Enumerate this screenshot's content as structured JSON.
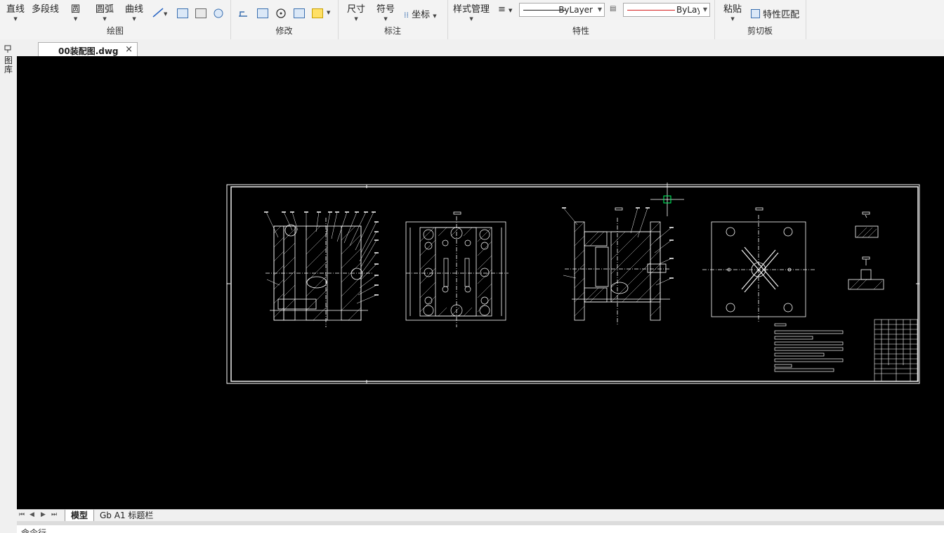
{
  "ribbon": {
    "draw": {
      "label": "绘图",
      "line": "直线",
      "polyline": "多段线",
      "circle": "圆",
      "arc": "圆弧",
      "curve": "曲线"
    },
    "modify": {
      "label": "修改"
    },
    "annotate": {
      "label": "标注",
      "dimension": "尺寸",
      "symbol": "符号",
      "coordinate": "坐标"
    },
    "properties": {
      "label": "特性",
      "style_manager": "样式管理",
      "linetype": "ByLayer",
      "color": "ByLayer",
      "color_hex": "#d62020"
    },
    "clipboard": {
      "label": "剪切板",
      "paste": "粘贴",
      "match_properties": "特性匹配"
    }
  },
  "document_tab": {
    "name": "00装配图.dwg",
    "close": "×"
  },
  "sidebar": {
    "label": "图库"
  },
  "layout_tabs": [
    {
      "label": "模型",
      "active": true
    },
    {
      "label": "Gb A1 标题栏",
      "active": false
    }
  ],
  "command_line": {
    "label": "命令行"
  },
  "colors": {
    "canvas": "#000000",
    "drawing": "#ffffff",
    "cursor": "#00ff66"
  }
}
